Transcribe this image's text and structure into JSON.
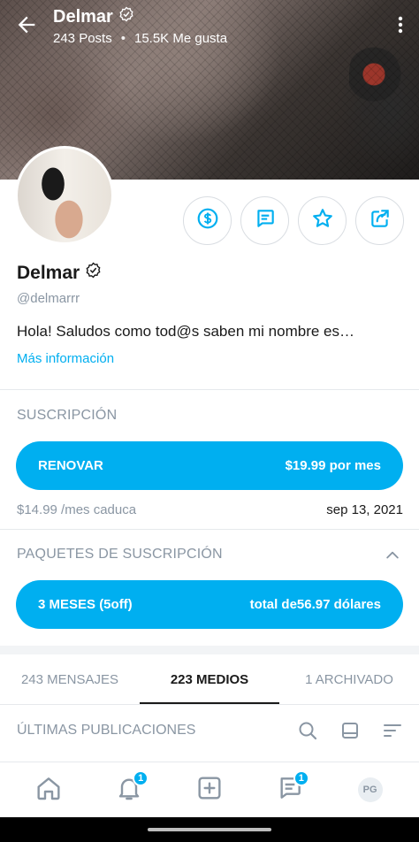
{
  "header": {
    "name": "Delmar",
    "posts": "243 Posts",
    "likes": "15.5K Me gusta",
    "separator": "•"
  },
  "profile": {
    "name": "Delmar",
    "handle": "@delmarrr",
    "bio": "Hola! Saludos como tod@s saben mi nombre es…",
    "more_info": "Más información"
  },
  "subscription": {
    "title": "SUSCRIPCIÓN",
    "renew_label": "RENOVAR",
    "renew_price": "$19.99 por mes",
    "old_price": "$14.99 /mes caduca",
    "expire_date": "sep 13, 2021"
  },
  "bundles": {
    "title": "PAQUETES DE SUSCRIPCIÓN",
    "bundle_label": "3 MESES (5off)",
    "bundle_price": "total de56.97 dólares"
  },
  "tabs": [
    {
      "label": "243 MENSAJES"
    },
    {
      "label": "223 MEDIOS"
    },
    {
      "label": "1 ARCHIVADO"
    }
  ],
  "latest": {
    "title": "ÚLTIMAS PUBLICACIONES"
  },
  "nav": {
    "notifications_badge": "1",
    "messages_badge": "1",
    "avatar_initials": "PG"
  },
  "colors": {
    "accent": "#00aff0",
    "muted": "#8a96a3"
  }
}
